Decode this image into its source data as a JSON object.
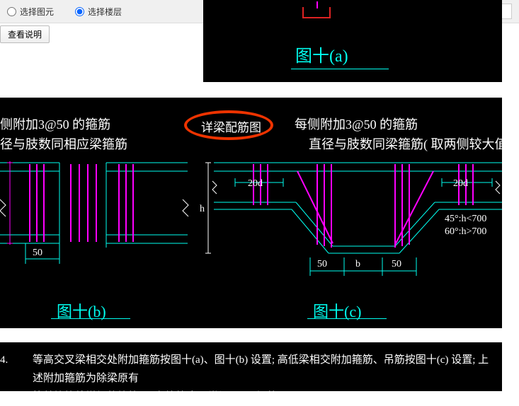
{
  "toolbar": {
    "opt1": "选择图元",
    "opt2": "选择楼层",
    "help_btn": "查看说明"
  },
  "top_fig": {
    "label": "图十(a)"
  },
  "main": {
    "left_t1": "侧附加3@50 的箍筋",
    "left_t2": "径与肢数同相应梁箍筋",
    "right_t1": "每侧附加3@50 的箍筋",
    "right_t2": "直径与肢数同梁箍筋( 取两侧较大值)",
    "center_title": "详梁配筋图",
    "d20d_l": "20d",
    "d20d_r": "20d",
    "h_l": "h",
    "d50_l": "50",
    "d50_c": "50",
    "d50_r": "50",
    "b_r": "b",
    "ang_line1": "45°:h<700",
    "ang_line2": "60°:h>700",
    "fig_b": "图十(b)",
    "fig_c": "图十(c)"
  },
  "note": {
    "prefix": "4.",
    "line1": "等高交叉梁相交处附加箍筋按图十(a)、图十(b) 设置; 高低梁相交附加箍筋、吊筋按图十(c) 设置; 上述附加箍筋为除梁原有",
    "line2": "抗剪箍筋外增加的箍筋, 原有箍筋应照常设置, 不得共用。"
  }
}
